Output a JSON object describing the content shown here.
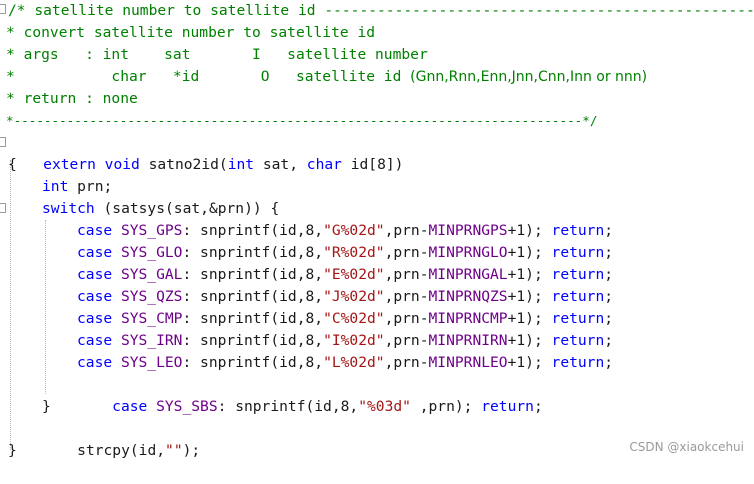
{
  "code": {
    "comment": {
      "l1": "/* satellite number to satellite id ",
      "l1_dash": "-------------------------------------------------",
      "l2": "* convert satellite number to satellite id",
      "l3": "* args   : int    sat       I   satellite number",
      "l4_a": "*           char   *id       O   satellite id ",
      "l4_b": "(Gnn,Rnn,Enn,Jnn,Cnn,Inn or nnn)",
      "l5": "* return : none",
      "l6": "*---------------------------------------------------------------------------*/"
    },
    "sig": {
      "kw1": "extern",
      "kw2": "void",
      "name": " satno2id(",
      "kw3": "int",
      "p1": " sat, ",
      "kw4": "char",
      "p2": " id[8])"
    },
    "open_brace": "{",
    "decl_kw": "int",
    "decl_rest": " prn;",
    "switch_kw": "switch",
    "switch_rest": " (satsys(sat,&prn)) {",
    "cases": [
      {
        "sys": "SYS_GPS",
        "fmt": "\"G%02d\"",
        "min": "MINPRNGPS"
      },
      {
        "sys": "SYS_GLO",
        "fmt": "\"R%02d\"",
        "min": "MINPRNGLO"
      },
      {
        "sys": "SYS_GAL",
        "fmt": "\"E%02d\"",
        "min": "MINPRNGAL"
      },
      {
        "sys": "SYS_QZS",
        "fmt": "\"J%02d\"",
        "min": "MINPRNQZS"
      },
      {
        "sys": "SYS_CMP",
        "fmt": "\"C%02d\"",
        "min": "MINPRNCMP"
      },
      {
        "sys": "SYS_IRN",
        "fmt": "\"I%02d\"",
        "min": "MINPRNIRN"
      },
      {
        "sys": "SYS_LEO",
        "fmt": "\"L%02d\"",
        "min": "MINPRNLEO"
      }
    ],
    "case_kw": "case",
    "return_kw": "return",
    "sbs": {
      "sys": "SYS_SBS",
      "fmt": "\"%03d\"",
      "rest": " ,prn); "
    },
    "close_switch": "}",
    "strcpy": "strcpy(id,",
    "strcpy_str": "\"\"",
    "strcpy_end": ");",
    "close_brace": "}"
  },
  "watermark": "CSDN @xiaokcehui"
}
